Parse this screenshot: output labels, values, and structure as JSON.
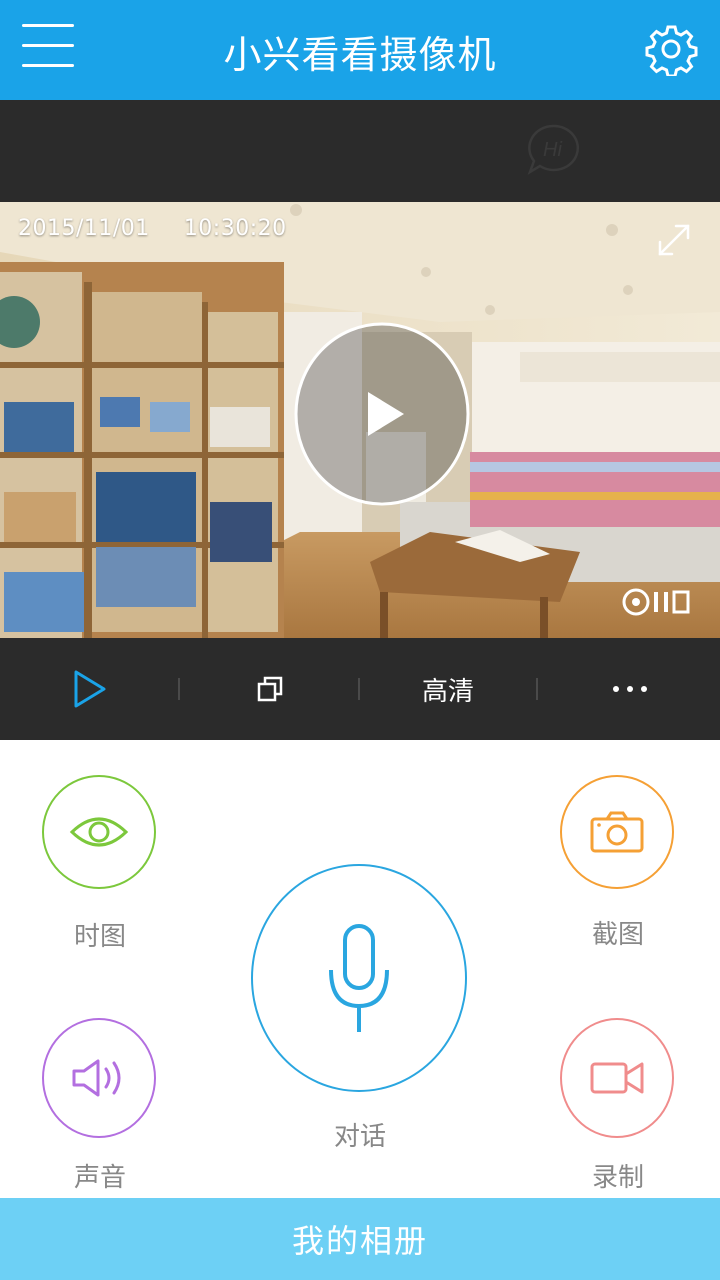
{
  "header": {
    "title": "小兴看看摄像机",
    "menu_icon": "menu-icon",
    "settings_icon": "gear-icon"
  },
  "video": {
    "date": "2015/11/01",
    "time": "10:30:20",
    "hi_badge": "Hi"
  },
  "controls": {
    "play_icon": "play-icon",
    "multiview_icon": "copy-icon",
    "quality_label": "高清",
    "more_icon": "more-dots-icon"
  },
  "actions": {
    "timeline_label": "时图",
    "screenshot_label": "截图",
    "talk_label": "对话",
    "sound_label": "声音",
    "record_label": "录制"
  },
  "bottom": {
    "album_label": "我的相册"
  },
  "colors": {
    "header": "#1aa3e8",
    "dark": "#2b2b2b",
    "timeline": "#7cc83c",
    "screenshot": "#f5a035",
    "talk": "#2aa6e0",
    "sound": "#b36fe0",
    "record": "#f08c8c",
    "album": "#6dd0f5"
  }
}
